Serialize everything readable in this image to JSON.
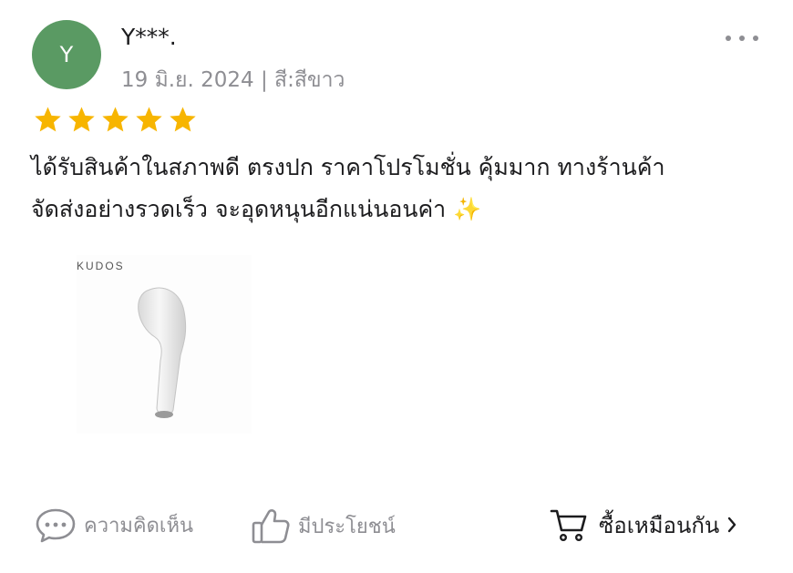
{
  "reviewer": {
    "avatar_letter": "Y",
    "avatar_color": "#5a9a63",
    "name": "Y***.",
    "meta": "19 มิ.ย. 2024 | สี:สีขาว"
  },
  "rating": {
    "stars": 5,
    "max": 5,
    "star_color": "#f7b500"
  },
  "review": {
    "line1": "ได้รับสินค้าในสภาพดี ตรงปก ราคาโปรโมชั่น คุ้มมาก ทางร้านค้า",
    "line2": "จัดส่งอย่างรวดเร็ว จะอุดหนุนอีกแน่นอนค่า ✨"
  },
  "photo": {
    "brand_text": "KUDOS"
  },
  "actions": {
    "comment_label": "ความคิดเห็น",
    "helpful_label": "มีประโยชน์",
    "buy_same_label": "ซื้อเหมือนกัน"
  },
  "icons": [
    "more-dots-icon",
    "star-icon",
    "comment-bubble-icon",
    "thumbs-up-icon",
    "cart-icon",
    "chevron-right-icon"
  ]
}
